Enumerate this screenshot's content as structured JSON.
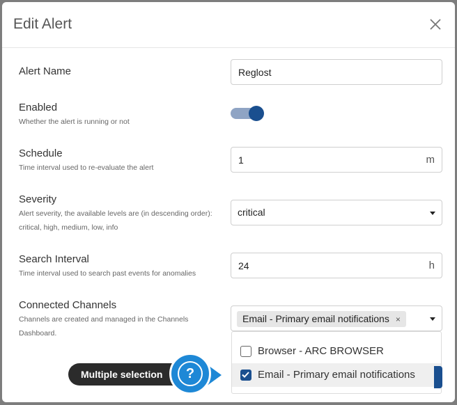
{
  "modal": {
    "title": "Edit Alert",
    "close_label": "×"
  },
  "fields": {
    "alert_name": {
      "label": "Alert Name",
      "value": "Reglost"
    },
    "enabled": {
      "label": "Enabled",
      "help": "Whether the alert is running or not",
      "on": true
    },
    "schedule": {
      "label": "Schedule",
      "help": "Time interval used to re-evaluate the alert",
      "value": "1",
      "unit": "m"
    },
    "severity": {
      "label": "Severity",
      "help_line1": "Alert severity, the available levels are (in descending order):",
      "help_line2": "critical, high, medium, low, info",
      "value": "critical"
    },
    "search_interval": {
      "label": "Search Interval",
      "help": "Time interval used to search past events for anomalies",
      "value": "24",
      "unit": "h"
    },
    "connected_channels": {
      "label": "Connected Channels",
      "help_line1": "Channels are created and managed in the Channels",
      "help_line2": "Dashboard.",
      "selected_chip": "Email - Primary email notifications",
      "chip_remove": "×",
      "options": [
        {
          "label": "Browser - ARC BROWSER",
          "checked": false
        },
        {
          "label": "Email - Primary email notifications",
          "checked": true
        }
      ]
    }
  },
  "tooltip": {
    "text": "Multiple selection",
    "icon": "question-icon",
    "glyph": "?"
  },
  "colors": {
    "accent": "#1a4f8f",
    "toggle_track": "#8fa4c4",
    "help_bubble": "#1e88d6",
    "tooltip_bg": "#2b2b2b"
  }
}
